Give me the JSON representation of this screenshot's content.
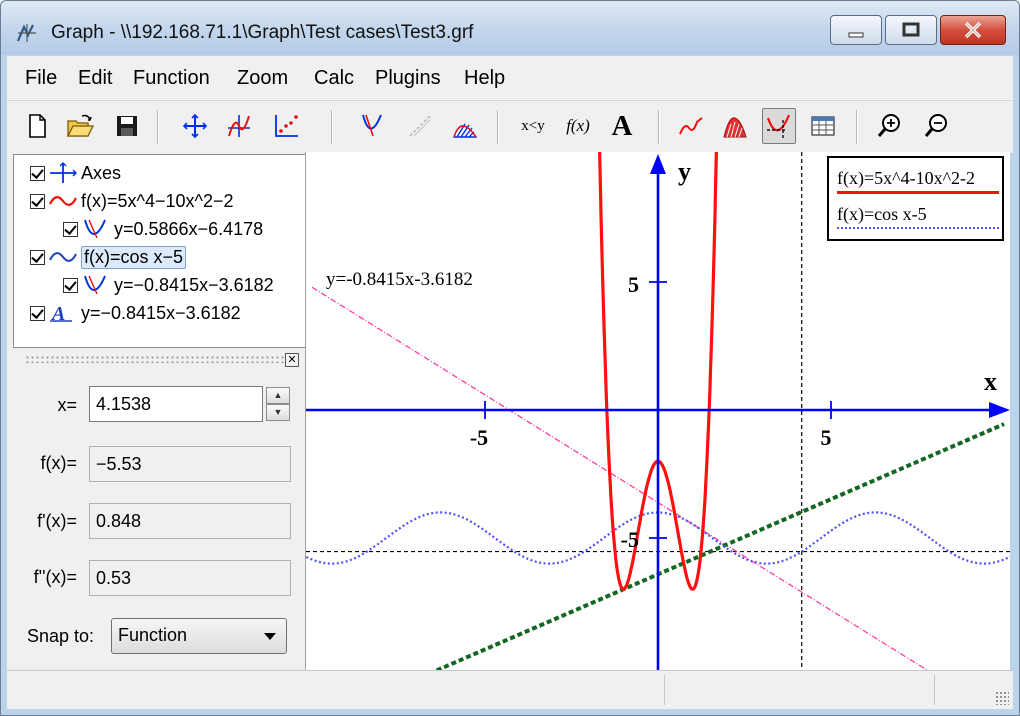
{
  "window": {
    "title": "Graph - \\\\192.168.71.1\\Graph\\Test cases\\Test3.grf",
    "controls": [
      "minimize",
      "maximize",
      "close"
    ]
  },
  "menu": [
    "File",
    "Edit",
    "Function",
    "Zoom",
    "Calc",
    "Plugins",
    "Help"
  ],
  "toolbar": {
    "buttons": [
      "new-icon",
      "open-icon",
      "save-icon",
      "axes-icon",
      "insert-function-icon",
      "insert-point-series-icon",
      "insert-tangent-icon",
      "insert-relation-icon",
      "insert-shading-icon",
      "evaluate-icon",
      "table-function-icon",
      "insert-label-icon",
      "zoom-window-icon",
      "area-icon",
      "path-icon",
      "table-icon",
      "zoom-in-icon",
      "zoom-out-icon"
    ],
    "text_evaluate": "x<y",
    "text_fx": "f(x)",
    "text_label": "A",
    "pressed": "path-icon"
  },
  "tree": [
    {
      "label": "Axes",
      "checked": true,
      "icon": "axes-icon",
      "level": 0
    },
    {
      "label": "f(x)=5x^4−10x^2−2",
      "checked": true,
      "icon": "function-icon",
      "level": 0
    },
    {
      "label": "y=0.5866x−6.4178",
      "checked": true,
      "icon": "tangent-icon",
      "level": 1
    },
    {
      "label": "f(x)=cos x−5",
      "checked": true,
      "icon": "function-icon",
      "level": 0,
      "selected": true
    },
    {
      "label": "y=−0.8415x−3.6182",
      "checked": true,
      "icon": "tangent-icon",
      "level": 1
    },
    {
      "label": "y=−0.8415x−3.6182",
      "checked": true,
      "icon": "label-icon",
      "level": 0
    }
  ],
  "eval": {
    "x_label": "x=",
    "x_value": "4.1538",
    "f_label": "f(x)=",
    "f_value": "−5.53",
    "f1_label": "f'(x)=",
    "f1_value": "0.848",
    "f2_label": "f''(x)=",
    "f2_value": "0.53",
    "snap_label": "Snap to:",
    "snap_value": "Function"
  },
  "plot": {
    "x_axis_label": "x",
    "y_axis_label": "y",
    "tick_neg5": "-5",
    "tick_pos5": "5",
    "ytick_5": "5",
    "ytick_neg5": "-5",
    "annotation": "y=-0.8415x-3.6182",
    "legend": [
      "f(x)=5x^4-10x^2-2",
      "f(x)=cos x-5"
    ],
    "colors": {
      "f1": "#ff1010",
      "f2": "#5050ff",
      "tangent1": "#116622",
      "tangent2": "#ff3fa0",
      "axes": "#0000ff"
    },
    "xlim": [
      -10,
      10
    ],
    "ylim": [
      -11,
      7.5
    ],
    "trace_x": 4.1538,
    "trace_y": -5.53
  },
  "status": [
    "",
    "",
    ""
  ]
}
